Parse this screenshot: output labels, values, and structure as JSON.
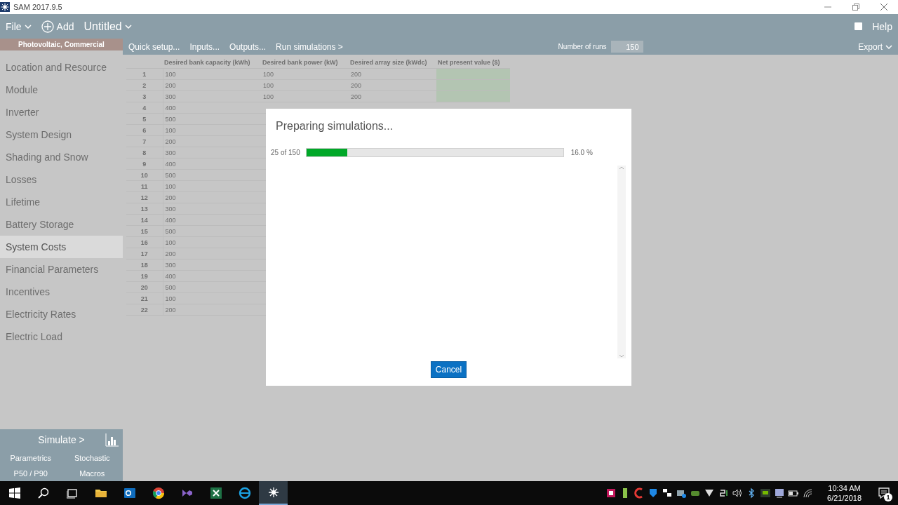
{
  "window": {
    "title": "SAM 2017.9.5"
  },
  "toolbar": {
    "file_menu": "File",
    "add_button": "Add",
    "case_menu": "Untitled",
    "help_button": "Help"
  },
  "sidebar": {
    "header": "Photovoltaic, Commercial",
    "items": [
      {
        "label": "Location and Resource",
        "selected": false
      },
      {
        "label": "Module",
        "selected": false
      },
      {
        "label": "Inverter",
        "selected": false
      },
      {
        "label": "System Design",
        "selected": false
      },
      {
        "label": "Shading and Snow",
        "selected": false
      },
      {
        "label": "Losses",
        "selected": false
      },
      {
        "label": "Lifetime",
        "selected": false
      },
      {
        "label": "Battery Storage",
        "selected": false
      },
      {
        "label": "System Costs",
        "selected": true
      },
      {
        "label": "Financial Parameters",
        "selected": false
      },
      {
        "label": "Incentives",
        "selected": false
      },
      {
        "label": "Electricity Rates",
        "selected": false
      },
      {
        "label": "Electric Load",
        "selected": false
      }
    ]
  },
  "simulate_panel": {
    "simulate_button": "Simulate >",
    "buttons": [
      "Parametrics",
      "Stochastic",
      "P50 / P90",
      "Macros"
    ]
  },
  "parametric_bar": {
    "links": [
      "Quick setup...",
      "Inputs...",
      "Outputs...",
      "Run simulations >"
    ],
    "runs_label": "Number of runs",
    "runs_value": "150",
    "export_button": "Export"
  },
  "table": {
    "columns": [
      "Desired bank capacity (kWh)",
      "Desired bank power (kW)",
      "Desired array size (kWdc)",
      "Net present value ($)"
    ],
    "rows": [
      {
        "number": "1",
        "capacity": "100",
        "power": "100",
        "array": "200",
        "npv_done": true
      },
      {
        "number": "2",
        "capacity": "200",
        "power": "100",
        "array": "200",
        "npv_done": true
      },
      {
        "number": "3",
        "capacity": "300",
        "power": "100",
        "array": "200",
        "npv_done": true
      },
      {
        "number": "4",
        "capacity": "400",
        "npv_done": false
      },
      {
        "number": "5",
        "capacity": "500"
      },
      {
        "number": "6",
        "capacity": "100"
      },
      {
        "number": "7",
        "capacity": "200"
      },
      {
        "number": "8",
        "capacity": "300"
      },
      {
        "number": "9",
        "capacity": "400"
      },
      {
        "number": "10",
        "capacity": "500"
      },
      {
        "number": "11",
        "capacity": "100"
      },
      {
        "number": "12",
        "capacity": "200"
      },
      {
        "number": "13",
        "capacity": "300"
      },
      {
        "number": "14",
        "capacity": "400"
      },
      {
        "number": "15",
        "capacity": "500"
      },
      {
        "number": "16",
        "capacity": "100"
      },
      {
        "number": "17",
        "capacity": "200"
      },
      {
        "number": "18",
        "capacity": "300"
      },
      {
        "number": "19",
        "capacity": "400"
      },
      {
        "number": "20",
        "capacity": "500"
      },
      {
        "number": "21",
        "capacity": "100"
      },
      {
        "number": "22",
        "capacity": "200"
      }
    ]
  },
  "dialog": {
    "title": "Preparing simulations...",
    "progress": {
      "count": "25 of 150",
      "level": 0.16,
      "percent": "16.0 %"
    },
    "cancel_button": "Cancel"
  },
  "taskbar": {
    "apps": [
      {
        "kind": "folder",
        "active": false
      },
      {
        "kind": "mail",
        "active": false
      },
      {
        "kind": "browser",
        "active": false
      },
      {
        "kind": "studio",
        "active": false
      },
      {
        "kind": "sheet",
        "active": false
      },
      {
        "kind": "web",
        "active": false
      },
      {
        "kind": "sun",
        "active": true
      }
    ],
    "clock": {
      "time": "10:34 AM",
      "date": "6/21/2018"
    },
    "notification_count": "1"
  }
}
